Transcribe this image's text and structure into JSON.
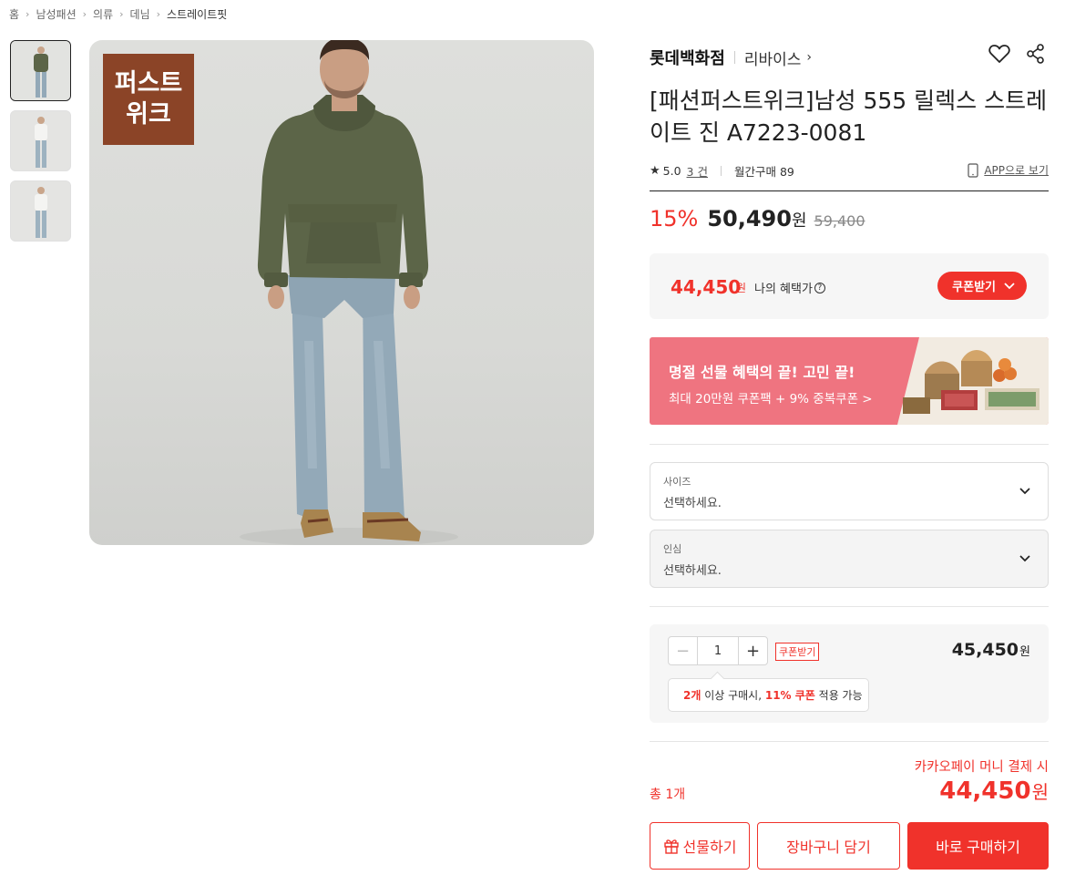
{
  "breadcrumb": [
    "홈",
    "남성패션",
    "의류",
    "데님",
    "스트레이트핏"
  ],
  "thumbnails_count": 3,
  "main_image": {
    "badge_line1": "퍼스트",
    "badge_line2": "위크"
  },
  "brand": {
    "name": "롯데백화점",
    "sub": "리바이스"
  },
  "product": {
    "title": "[패션퍼스트위크]남성 555 릴렉스 스트레이트 진 A7223-0081"
  },
  "rating": {
    "score": "5.0",
    "count": "3 건",
    "monthly": "월간구매 89",
    "app_link": "APP으로 보기"
  },
  "price": {
    "discount": "15%",
    "sale": "50,490",
    "won": "원",
    "original": "59,400"
  },
  "benefit": {
    "price": "44,450",
    "won": "원",
    "label": "나의 혜택가",
    "help": "?",
    "coupon_button": "쿠폰받기"
  },
  "banner": {
    "title": "명절 선물 혜택의 끝! 고민 끝!",
    "subtitle": "최대 20만원 쿠폰팩 + 9% 중복쿠폰 >"
  },
  "options": [
    {
      "label": "사이즈",
      "value": "선택하세요."
    },
    {
      "label": "인심",
      "value": "선택하세요."
    }
  ],
  "quantity": {
    "minus": "−",
    "value": "1",
    "plus": "+",
    "coupon_tag": "쿠폰받기",
    "line_price": "45,450",
    "won": "원"
  },
  "tooltip": {
    "qty": "2개",
    "text1": " 이상 구매시, ",
    "pct": "11% 쿠폰",
    "text2": " 적용 가능"
  },
  "summary": {
    "kakao": "카카오페이 머니 결제 시",
    "total_count": "총 1개",
    "total_price": "44,450",
    "won": "원"
  },
  "actions": {
    "gift": "선물하기",
    "cart": "장바구니 담기",
    "buy": "바로 구매하기"
  },
  "colors": {
    "accent": "#f0322b",
    "badge": "#8b4427",
    "banner": "#ef7480",
    "hoodie": "#5c6548",
    "jeans": "#93a9b8"
  }
}
